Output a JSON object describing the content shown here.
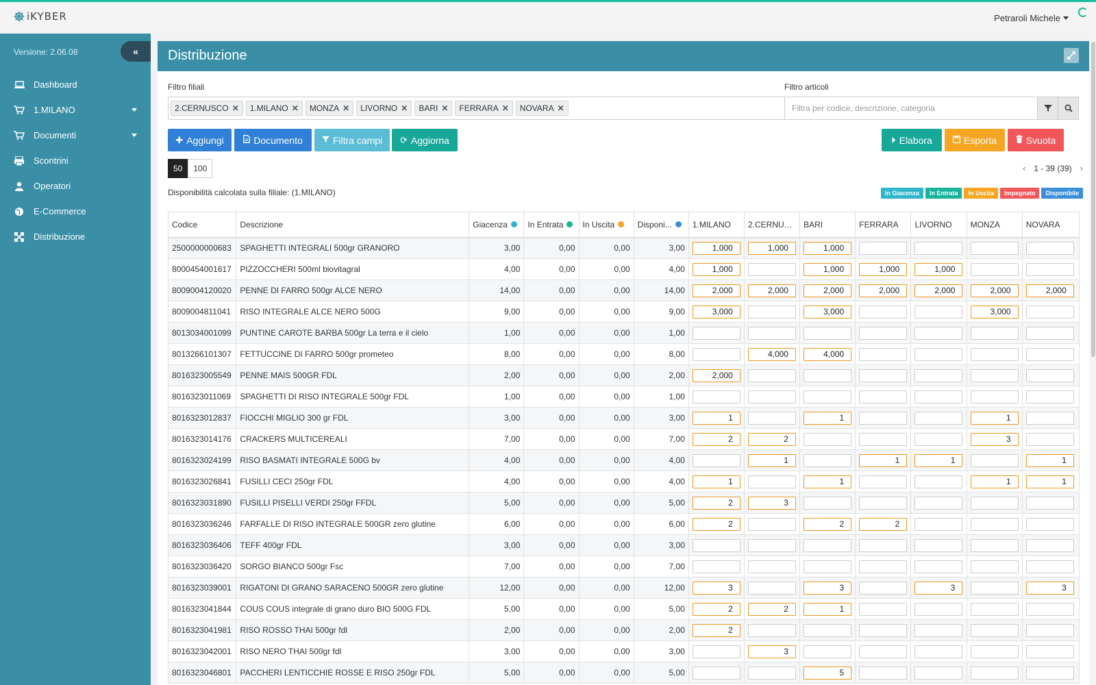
{
  "app": {
    "logo": "iKYBER",
    "user": "Petraroli Michele"
  },
  "sidebar": {
    "version": "Versione: 2.06.08",
    "items": [
      {
        "label": "Dashboard",
        "icon": "laptop-icon"
      },
      {
        "label": "1.MILANO",
        "icon": "cart-icon",
        "has_caret": true
      },
      {
        "label": "Documenti",
        "icon": "cart-icon",
        "has_caret": true
      },
      {
        "label": "Scontrini",
        "icon": "receipt-icon"
      },
      {
        "label": "Operatori",
        "icon": "user-icon"
      },
      {
        "label": "E-Commerce",
        "icon": "globe-icon"
      },
      {
        "label": "Distribuzione",
        "icon": "distribution-icon"
      }
    ]
  },
  "page": {
    "title": "Distribuzione",
    "filter_branches_label": "Filtro filiali",
    "branch_tags": [
      "2.CERNUSCO",
      "1.MILANO",
      "MONZA",
      "LIVORNO",
      "BARI",
      "FERRARA",
      "NOVARA"
    ],
    "filter_articles_label": "Filtro articoli",
    "filter_articles_placeholder": "Filtra per codice, descrizione, categoria"
  },
  "toolbar": {
    "add": "Aggiungi",
    "document": "Documento",
    "filter_fields": "Filtra campi",
    "refresh": "Aggiorna",
    "process": "Elabora",
    "export": "Esporta",
    "empty": "Svuota"
  },
  "pager": {
    "sizes": [
      "50",
      "100"
    ],
    "active": "50",
    "range": "1 - 39 (39)"
  },
  "availability_note": "Disponibilità calcolata sulla filiale: (1.MILANO)",
  "legend": [
    {
      "label": "In Giacenza",
      "color": "#2fb4c9"
    },
    {
      "label": "In Entrata",
      "color": "#17b39b"
    },
    {
      "label": "In Uscita",
      "color": "#f5a623"
    },
    {
      "label": "Impegnato",
      "color": "#f2565a"
    },
    {
      "label": "Disponibile",
      "color": "#3a8fd9"
    }
  ],
  "table": {
    "columns": [
      "Codice",
      "Descrizione",
      "Giacenza",
      "In Entrata",
      "In Uscita",
      "Disponi...",
      "1.MILANO",
      "2.CERNUS...",
      "BARI",
      "FERRARA",
      "LIVORNO",
      "MONZA",
      "NOVARA"
    ],
    "column_dots": {
      "2": "#2fb4c9",
      "3": "#17b39b",
      "4": "#f5a623",
      "5": "#3a8fd9"
    },
    "rows": [
      {
        "codice": "2500000000683",
        "descrizione": "SPAGHETTI INTEGRALI 500gr GRANORO",
        "giacenza": "3,00",
        "entrata": "0,00",
        "uscita": "0,00",
        "disponibile": "3,00",
        "branches": [
          "1,000",
          "1,000",
          "1,000",
          "",
          "",
          "",
          ""
        ]
      },
      {
        "codice": "8000454001617",
        "descrizione": "PIZZOCCHERI 500ml biovitagral",
        "giacenza": "4,00",
        "entrata": "0,00",
        "uscita": "0,00",
        "disponibile": "4,00",
        "branches": [
          "1,000",
          "",
          "1,000",
          "1,000",
          "1,000",
          "",
          ""
        ]
      },
      {
        "codice": "8009004120020",
        "descrizione": "PENNE DI FARRO 500gr ALCE NERO",
        "giacenza": "14,00",
        "entrata": "0,00",
        "uscita": "0,00",
        "disponibile": "14,00",
        "branches": [
          "2,000",
          "2,000",
          "2,000",
          "2,000",
          "2,000",
          "2,000",
          "2,000"
        ]
      },
      {
        "codice": "8009004811041",
        "descrizione": "RISO INTEGRALE ALCE NERO 500G",
        "giacenza": "9,00",
        "entrata": "0,00",
        "uscita": "0,00",
        "disponibile": "9,00",
        "branches": [
          "3,000",
          "",
          "3,000",
          "",
          "",
          "3,000",
          ""
        ]
      },
      {
        "codice": "8013034001099",
        "descrizione": "PUNTINE CAROTE BARBA 500gr La terra e il cielo",
        "giacenza": "1,00",
        "entrata": "0,00",
        "uscita": "0,00",
        "disponibile": "1,00",
        "branches": [
          "",
          "",
          "",
          "",
          "",
          "",
          ""
        ]
      },
      {
        "codice": "8013266101307",
        "descrizione": "FETTUCCINE DI FARRO 500gr prometeo",
        "giacenza": "8,00",
        "entrata": "0,00",
        "uscita": "0,00",
        "disponibile": "8,00",
        "branches": [
          "",
          "4,000",
          "4,000",
          "",
          "",
          "",
          ""
        ]
      },
      {
        "codice": "8016323005549",
        "descrizione": "PENNE MAIS 500GR FDL",
        "giacenza": "2,00",
        "entrata": "0,00",
        "uscita": "0,00",
        "disponibile": "2,00",
        "branches": [
          "2,000",
          "",
          "",
          "",
          "",
          "",
          ""
        ]
      },
      {
        "codice": "8016323011069",
        "descrizione": "SPAGHETTI DI RISO INTEGRALE 500gr FDL",
        "giacenza": "1,00",
        "entrata": "0,00",
        "uscita": "0,00",
        "disponibile": "1,00",
        "branches": [
          "",
          "",
          "",
          "",
          "",
          "",
          ""
        ]
      },
      {
        "codice": "8016323012837",
        "descrizione": "FIOCCHI MIGLIO 300 gr FDL",
        "giacenza": "3,00",
        "entrata": "0,00",
        "uscita": "0,00",
        "disponibile": "3,00",
        "branches": [
          "1",
          "",
          "1",
          "",
          "",
          "1",
          ""
        ]
      },
      {
        "codice": "8016323014176",
        "descrizione": "CRACKERS MULTICEREALI",
        "giacenza": "7,00",
        "entrata": "0,00",
        "uscita": "0,00",
        "disponibile": "7,00",
        "branches": [
          "2",
          "2",
          "",
          "",
          "",
          "3",
          ""
        ]
      },
      {
        "codice": "8016323024199",
        "descrizione": "RISO BASMATI INTEGRALE 500G bv",
        "giacenza": "4,00",
        "entrata": "0,00",
        "uscita": "0,00",
        "disponibile": "4,00",
        "branches": [
          "",
          "1",
          "",
          "1",
          "1",
          "",
          "1"
        ]
      },
      {
        "codice": "8016323026841",
        "descrizione": "FUSILLI CECI 250gr FDL",
        "giacenza": "4,00",
        "entrata": "0,00",
        "uscita": "0,00",
        "disponibile": "4,00",
        "branches": [
          "1",
          "",
          "1",
          "",
          "",
          "1",
          "1"
        ]
      },
      {
        "codice": "8016323031890",
        "descrizione": "FUSILLI PISELLI VERDI 250gr FFDL",
        "giacenza": "5,00",
        "entrata": "0,00",
        "uscita": "0,00",
        "disponibile": "5,00",
        "branches": [
          "2",
          "3",
          "",
          "",
          "",
          "",
          ""
        ]
      },
      {
        "codice": "8016323036246",
        "descrizione": "FARFALLE DI RISO INTEGRALE 500GR zero glutine",
        "giacenza": "6,00",
        "entrata": "0,00",
        "uscita": "0,00",
        "disponibile": "6,00",
        "branches": [
          "2",
          "",
          "2",
          "2",
          "",
          "",
          ""
        ]
      },
      {
        "codice": "8016323036406",
        "descrizione": "TEFF 400gr FDL",
        "giacenza": "3,00",
        "entrata": "0,00",
        "uscita": "0,00",
        "disponibile": "3,00",
        "branches": [
          "",
          "",
          "",
          "",
          "",
          "",
          ""
        ]
      },
      {
        "codice": "8016323036420",
        "descrizione": "SORGO BIANCO 500gr Fsc",
        "giacenza": "7,00",
        "entrata": "0,00",
        "uscita": "0,00",
        "disponibile": "7,00",
        "branches": [
          "",
          "",
          "",
          "",
          "",
          "",
          ""
        ]
      },
      {
        "codice": "8016323039001",
        "descrizione": "RIGATONI DI GRANO SARACENO 500GR zero glutine",
        "giacenza": "12,00",
        "entrata": "0,00",
        "uscita": "0,00",
        "disponibile": "12,00",
        "branches": [
          "3",
          "",
          "3",
          "",
          "3",
          "",
          "3"
        ]
      },
      {
        "codice": "8016323041844",
        "descrizione": "COUS COUS integrale di grano duro BIO 500G FDL",
        "giacenza": "5,00",
        "entrata": "0,00",
        "uscita": "0,00",
        "disponibile": "5,00",
        "branches": [
          "2",
          "2",
          "1",
          "",
          "",
          "",
          ""
        ]
      },
      {
        "codice": "8016323041981",
        "descrizione": "RISO ROSSO THAI 500gr fdl",
        "giacenza": "2,00",
        "entrata": "0,00",
        "uscita": "0,00",
        "disponibile": "2,00",
        "branches": [
          "2",
          "",
          "",
          "",
          "",
          "",
          ""
        ]
      },
      {
        "codice": "8016323042001",
        "descrizione": "RISO NERO THAI 500gr fdl",
        "giacenza": "3,00",
        "entrata": "0,00",
        "uscita": "0,00",
        "disponibile": "3,00",
        "branches": [
          "",
          "3",
          "",
          "",
          "",
          "",
          ""
        ]
      },
      {
        "codice": "8016323046801",
        "descrizione": "PACCHERI LENTICCHIE ROSSE E RISO 250gr FDL",
        "giacenza": "5,00",
        "entrata": "0,00",
        "uscita": "0,00",
        "disponibile": "5,00",
        "branches": [
          "",
          "",
          "5",
          "",
          "",
          "",
          ""
        ]
      }
    ]
  },
  "colors": {
    "accent": "#3a8fa7",
    "btn_primary": "#2f80d6",
    "btn_info": "#5bbcd6",
    "btn_teal": "#17a89a",
    "btn_orange": "#f5a623",
    "btn_red": "#f2565a",
    "filled_input": "#f0961e"
  }
}
